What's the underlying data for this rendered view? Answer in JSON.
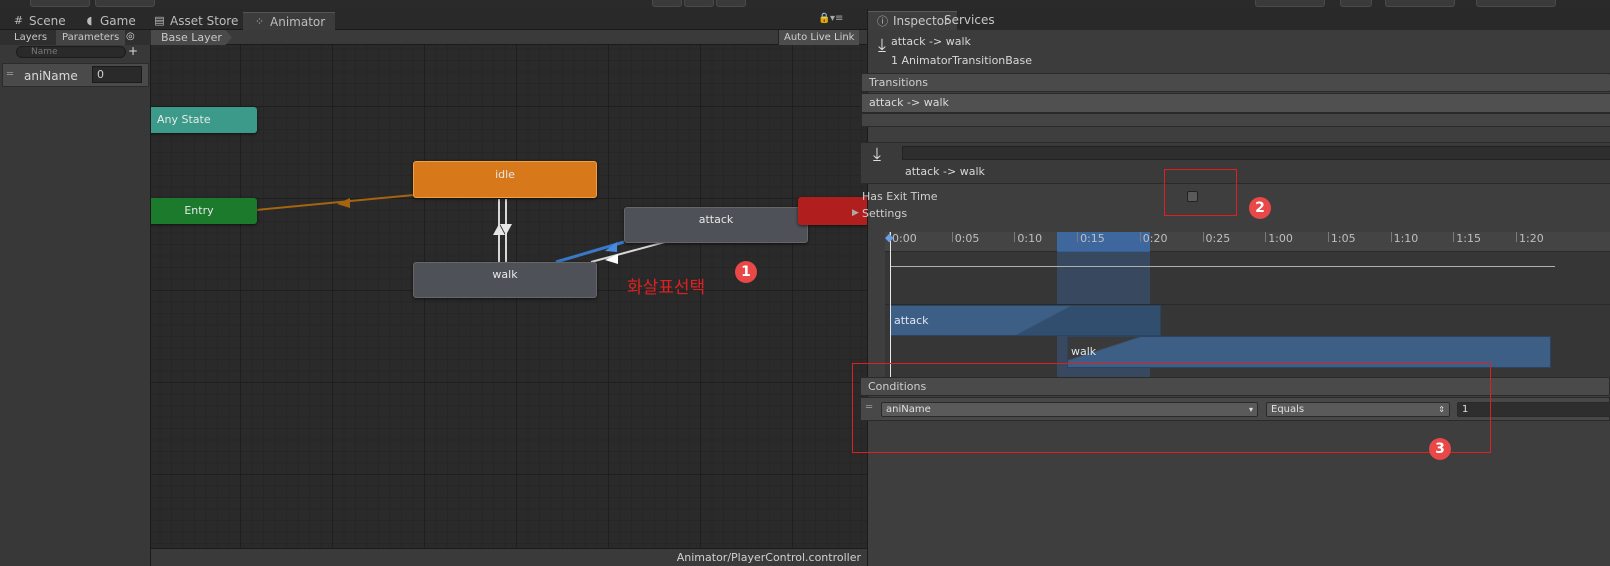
{
  "tabs": [
    {
      "label": "Scene",
      "icon": "grid-icon"
    },
    {
      "label": "Game",
      "icon": "pacman-icon"
    },
    {
      "label": "Asset Store",
      "icon": "store-icon"
    },
    {
      "label": "Animator",
      "icon": "animator-icon"
    }
  ],
  "left_panel": {
    "tabs": [
      "Layers",
      "Parameters"
    ],
    "search_placeholder": "Name",
    "parameter": {
      "name": "aniName",
      "value": "0"
    }
  },
  "graph": {
    "breadcrumb": "Base Layer",
    "auto_live_link": "Auto Live Link",
    "nodes": {
      "any_state": "Any State",
      "entry": "Entry",
      "idle": "idle",
      "attack": "attack",
      "walk": "walk"
    },
    "annotation": "화살표선택",
    "controller_path": "Animator/PlayerControl.controller"
  },
  "inspector": {
    "tabs": [
      "Inspector",
      "Services"
    ],
    "header_title": "attack -> walk",
    "header_subtitle": "1 AnimatorTransitionBase",
    "transitions_label": "Transitions",
    "transition_item": "attack -> walk",
    "transition_name": "attack -> walk",
    "has_exit_time_label": "Has Exit Time",
    "has_exit_time": false,
    "settings_label": "Settings",
    "timeline_ticks": [
      "0:00",
      "0:05",
      "0:10",
      "0:15",
      "0:20",
      "0:25",
      "1:00",
      "1:05",
      "1:10",
      "1:15",
      "1:20"
    ],
    "clip_attack": "attack",
    "clip_walk": "walk",
    "conditions_label": "Conditions",
    "condition": {
      "parameter": "aniName",
      "mode": "Equals",
      "value": "1"
    }
  },
  "badges": [
    "1",
    "2",
    "3"
  ],
  "colors": {
    "entry": "#1b7a2c",
    "any_state": "#3c9a8a",
    "idle": "#d7791a",
    "state": "#4e5258",
    "exit": "#b01e1e",
    "selection": "#3a78c8",
    "annotation": "#e02020"
  }
}
